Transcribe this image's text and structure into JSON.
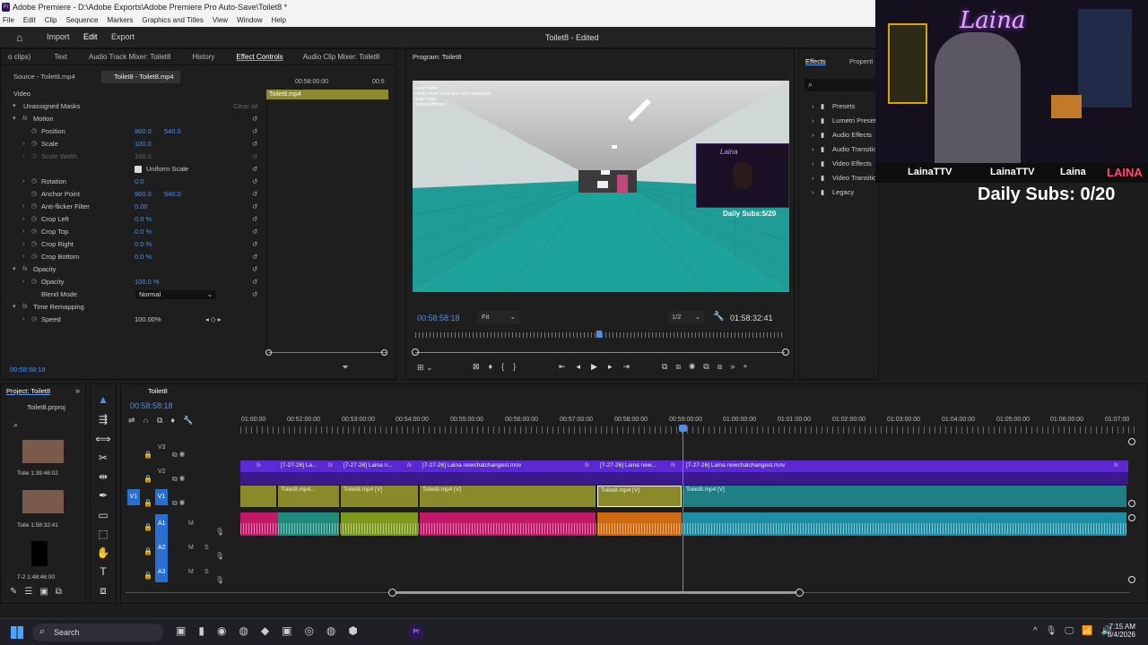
{
  "window": {
    "title": "Adobe Premiere - D:\\Adobe Exports\\Adobe Premiere Pro Auto-Save\\Toilet8 *",
    "app_badge": "Pr"
  },
  "menu": [
    "File",
    "Edit",
    "Clip",
    "Sequence",
    "Markers",
    "Graphics and Titles",
    "View",
    "Window",
    "Help"
  ],
  "workspace": {
    "tabs": [
      "Import",
      "Edit",
      "Export"
    ],
    "active": "Edit",
    "project_title": "Toilet8 - Edited"
  },
  "panels_top": {
    "tabs": [
      "o clips)",
      "Text",
      "Audio Track Mixer: Toilet8",
      "History",
      "Effect Controls",
      "Audio Clip Mixer: Toilet8"
    ],
    "source_tab": "Source - Toilet8.mp4",
    "active_clip_tab": "Toilet8 - Toilet8.mp4",
    "mini_timecode_start": "00:58:00:00",
    "mini_timecode_end": "00:5",
    "mini_clip": "Toilet8.mp4"
  },
  "effect_controls": {
    "section": "Video",
    "masks": "Unassigned Masks",
    "clear_all": "Clear all",
    "motion": "Motion",
    "position": {
      "label": "Position",
      "x": "960.0",
      "y": "540.0"
    },
    "scale": {
      "label": "Scale",
      "value": "100.0"
    },
    "scale_width": {
      "label": "Scale Width",
      "value": "100.0"
    },
    "uniform_scale": "Uniform Scale",
    "rotation": {
      "label": "Rotation",
      "value": "0.0"
    },
    "anchor": {
      "label": "Anchor Point",
      "x": "960.0",
      "y": "540.0"
    },
    "antiflicker": {
      "label": "Anti-flicker Filter",
      "value": "0.00"
    },
    "crop_left": {
      "label": "Crop Left",
      "value": "0.0 %"
    },
    "crop_top": {
      "label": "Crop Top",
      "value": "0.0 %"
    },
    "crop_right": {
      "label": "Crop Right",
      "value": "0.0 %"
    },
    "crop_bottom": {
      "label": "Crop Bottom",
      "value": "0.0 %"
    },
    "opacity_group": "Opacity",
    "opacity": {
      "label": "Opacity",
      "value": "100.0 %"
    },
    "blend_mode": {
      "label": "Blend Mode",
      "value": "Normal"
    },
    "time_remap": "Time Remapping",
    "speed": {
      "label": "Speed",
      "value": "100.00%"
    },
    "timecode": "00:58:58:18"
  },
  "program": {
    "tab": "Program: Toilet8",
    "timecode": "00:58:58:18",
    "fit": "Fit",
    "resolution": "1/2",
    "duration": "01:58:32:41",
    "overlay": {
      "chat1": "never mind",
      "chat2": "whats short Ilana fairy and I mustache thats hairy",
      "chat3": "looked different",
      "streamer_name": "Laina",
      "daily_subs": "Daily Subs:5/20"
    }
  },
  "effects": {
    "tab": "Effects",
    "tab2": "Properti",
    "items": [
      "Presets",
      "Lumetri Preset",
      "Audio Effects",
      "Audio Transitic",
      "Video Effects",
      "Video Transitic",
      "Legacy"
    ]
  },
  "webcam": {
    "name": "Laina",
    "socials": [
      "LainaTTV",
      "LainaTTV",
      "Laina"
    ],
    "banner": "LAINA",
    "daily_subs": "Daily Subs: 0/20"
  },
  "project": {
    "tab": "Project: Toilet8",
    "file": "Toilet8.prproj",
    "items": [
      {
        "name": "Toile",
        "dur": "1:39:46:02"
      },
      {
        "name": "Toile",
        "dur": "1:58:32:41"
      },
      {
        "name": "7-2",
        "dur": "1:48:46:00"
      }
    ]
  },
  "timeline": {
    "tab": "Toilet8",
    "timecode": "00:58:58:18",
    "ruler": [
      "01:00:00",
      "00:52:00:00",
      "00:53:00:00",
      "00:54:00:00",
      "00:55:00:00",
      "00:56:00:00",
      "00:57:00:00",
      "00:58:00:00",
      "00:59:00:00",
      "01:00:00:00",
      "01:01:00:00",
      "01:02:00:00",
      "01:03:00:00",
      "01:04:00:00",
      "01:05:00:00",
      "01:06:00:00",
      "01:07:00"
    ],
    "tracks": {
      "v3": "V3",
      "v2": "V2",
      "v1": "V1",
      "src_v1": "V1",
      "a1": "A1",
      "a2": "A2",
      "a3": "A3",
      "m": "M",
      "s": "S"
    },
    "v2_clips": [
      "[7-27-26] La...",
      "[7-27-26] Laina n...",
      "[7-27-26] Laina newchatchangest.mov",
      "[7-27-26] Laina new...",
      "[7-27-26] Laina newchatchangest.mov"
    ],
    "fx_badge": "fx",
    "v1_clips": [
      "Toilet8.mp4...",
      "Toilet8.mp4 [V]",
      "Toilet8.mp4 [V]",
      "Toilet8.mp4 [V]",
      "Toilet8.mp4 [V]"
    ]
  },
  "taskbar": {
    "search": "Search",
    "time": "7:15 AM",
    "date": "8/4/2026",
    "pr_badge": "Pr"
  },
  "colors": {
    "accent": "#4f8fe8",
    "v2_clip": "#5b2bd6",
    "v1_olive": "#8a8a2a",
    "v1_teal": "#1e7f85",
    "a_pink": "#c2186a"
  }
}
